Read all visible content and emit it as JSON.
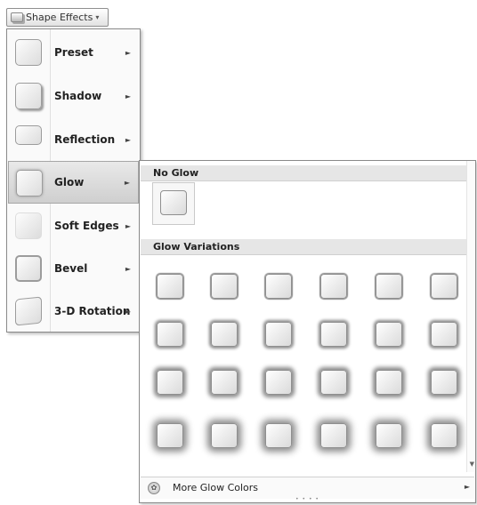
{
  "ribbon": {
    "button_label": "Shape Effects",
    "button_icon": "shape-icon",
    "dropdown_icon": "chevron-down-icon"
  },
  "menu": {
    "items": [
      {
        "label": "Preset"
      },
      {
        "label": "Shadow"
      },
      {
        "label": "Reflection"
      },
      {
        "label": "Glow",
        "active": true
      },
      {
        "label": "Soft Edges"
      },
      {
        "label": "Bevel"
      },
      {
        "label": "3-D Rotation"
      }
    ]
  },
  "submenu": {
    "no_glow_header": "No Glow",
    "variations_header": "Glow Variations",
    "more_colors_label": "More Glow Colors",
    "grid_rows": 4,
    "grid_cols": 6,
    "accent_colors": {
      "glow": "#8a8a8a",
      "header_bg": "#e6e6e6",
      "active_bg": "#d6d6d6"
    }
  }
}
